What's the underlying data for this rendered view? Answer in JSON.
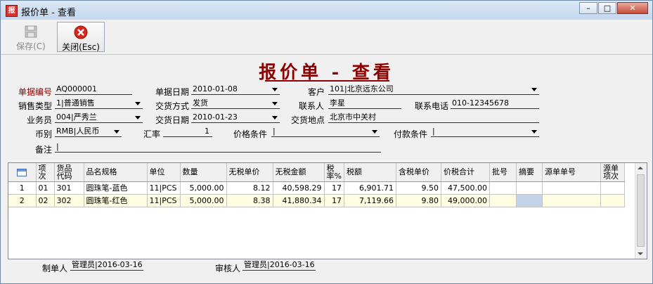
{
  "window": {
    "app_icon": "app-logo-icon",
    "title": "报价单 - 查看",
    "minimize": "–",
    "maximize": "□",
    "close": "✕"
  },
  "toolbar": {
    "save_label": "保存(C)",
    "close_label": "关闭(Esc)"
  },
  "form": {
    "title": "报价单 - 查看",
    "doc_no_label": "单据编号",
    "doc_no": "AQ000001",
    "doc_date_label": "单据日期",
    "doc_date": "2010-01-08",
    "customer_label": "客户",
    "customer": "101|北京远东公司",
    "sales_type_label": "销售类型",
    "sales_type": "1|普通销售",
    "delivery_method_label": "交货方式",
    "delivery_method": "发货",
    "contact_label": "联系人",
    "contact": "李星",
    "phone_label": "联系电话",
    "phone": "010-12345678",
    "salesperson_label": "业务员",
    "salesperson": "004|严秀兰",
    "delivery_date_label": "交货日期",
    "delivery_date": "2010-01-23",
    "delivery_place_label": "交货地点",
    "delivery_place": "北京市中关村",
    "currency_label": "币别",
    "currency": "RMB|人民币",
    "rate_label": "汇率",
    "rate": "1",
    "price_terms_label": "价格条件",
    "price_terms": "|",
    "payment_terms_label": "付款条件",
    "payment_terms": "|",
    "remark_label": "备注",
    "remark": "|"
  },
  "grid": {
    "headers": [
      "",
      "项\n次",
      "货品\n代码",
      "品名规格",
      "单位",
      "数量",
      "无税单价",
      "无税金额",
      "税\n率%",
      "税额",
      "含税单价",
      "价税合计",
      "批号",
      "摘要",
      "源单单号",
      "源单\n项次"
    ],
    "rows": [
      [
        "1",
        "01",
        "301",
        "圆珠笔-蓝色",
        "11|PCS",
        "5,000.00",
        "8.12",
        "40,598.29",
        "17",
        "6,901.71",
        "9.50",
        "47,500.00",
        "",
        "",
        "",
        ""
      ],
      [
        "2",
        "02",
        "302",
        "圆珠笔-红色",
        "11|PCS",
        "5,000.00",
        "8.38",
        "41,880.34",
        "17",
        "7,119.66",
        "9.80",
        "49,000.00",
        "",
        "",
        "",
        ""
      ]
    ]
  },
  "footer": {
    "maker_label": "制单人",
    "maker": "管理员|2016-03-16",
    "reviewer_label": "审核人",
    "reviewer": "管理员|2016-03-16"
  },
  "colors": {
    "title": "#8b0000",
    "selected_row": "#fffde1",
    "selected_cell": "#c3d3ea"
  }
}
